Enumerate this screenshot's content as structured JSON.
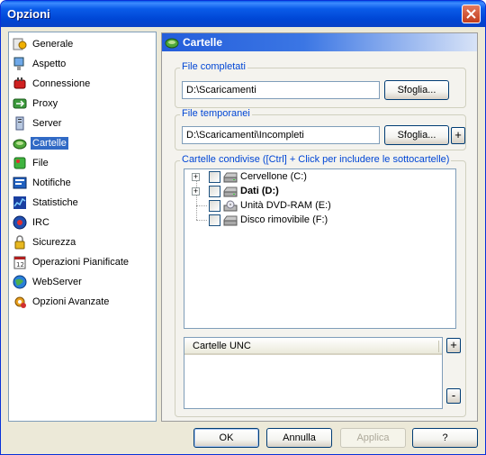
{
  "window": {
    "title": "Opzioni"
  },
  "sidebar": {
    "items": [
      {
        "label": "Generale",
        "icon": "general-icon",
        "selected": false
      },
      {
        "label": "Aspetto",
        "icon": "appearance-icon",
        "selected": false
      },
      {
        "label": "Connessione",
        "icon": "connection-icon",
        "selected": false
      },
      {
        "label": "Proxy",
        "icon": "proxy-icon",
        "selected": false
      },
      {
        "label": "Server",
        "icon": "server-icon",
        "selected": false
      },
      {
        "label": "Cartelle",
        "icon": "folders-icon",
        "selected": true
      },
      {
        "label": "File",
        "icon": "file-icon",
        "selected": false
      },
      {
        "label": "Notifiche",
        "icon": "notifications-icon",
        "selected": false
      },
      {
        "label": "Statistiche",
        "icon": "statistics-icon",
        "selected": false
      },
      {
        "label": "IRC",
        "icon": "irc-icon",
        "selected": false
      },
      {
        "label": "Sicurezza",
        "icon": "security-icon",
        "selected": false
      },
      {
        "label": "Operazioni Pianificate",
        "icon": "scheduler-icon",
        "selected": false
      },
      {
        "label": "WebServer",
        "icon": "webserver-icon",
        "selected": false
      },
      {
        "label": "Opzioni Avanzate",
        "icon": "advanced-options-icon",
        "selected": false
      }
    ]
  },
  "panel": {
    "title": "Cartelle",
    "completed": {
      "title": "File completati",
      "value": "D:\\Scaricamenti",
      "browse": "Sfoglia..."
    },
    "temp": {
      "title": "File temporanei",
      "value": "D:\\Scaricamenti\\Incompleti",
      "browse": "Sfoglia...",
      "add": "+"
    },
    "shared": {
      "title": "Cartelle condivise ([Ctrl] + Click per includere le sottocartelle)",
      "drives": [
        {
          "label": "Cervellone (C:)",
          "expandable": true,
          "bold": false,
          "icon": "hard-drive-icon"
        },
        {
          "label": "Dati (D:)",
          "expandable": true,
          "bold": true,
          "icon": "hard-drive-icon"
        },
        {
          "label": "Unità DVD-RAM (E:)",
          "expandable": false,
          "bold": false,
          "icon": "dvd-drive-icon"
        },
        {
          "label": "Disco rimovibile (F:)",
          "expandable": false,
          "bold": false,
          "icon": "removable-drive-icon"
        }
      ]
    },
    "unc": {
      "header": "Cartelle UNC",
      "add": "+",
      "remove": "-"
    }
  },
  "footer": {
    "ok": "OK",
    "cancel": "Annulla",
    "apply": "Applica",
    "help": "?"
  },
  "colors": {
    "accent": "#316ac5",
    "group_title": "#0046d5",
    "titlebar": "#0a5ce9"
  }
}
